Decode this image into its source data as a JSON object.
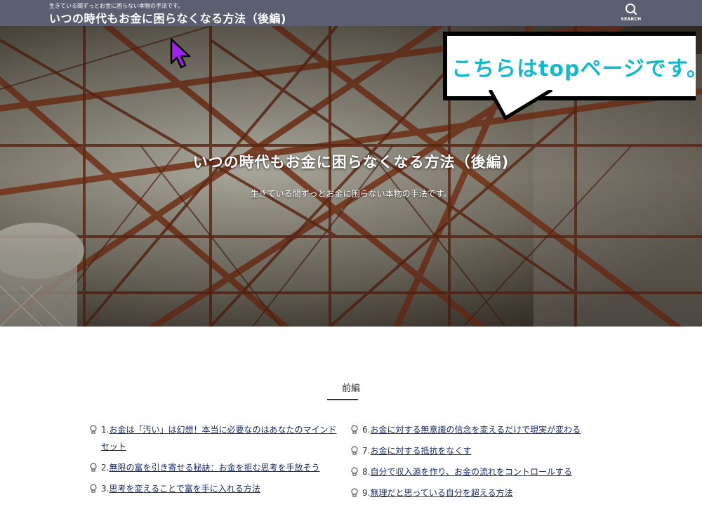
{
  "header": {
    "tagline": "生きている間ずっとお金に困らない本物の手法です。",
    "site_title": "いつの時代もお金に困らなくなる方法（後編)",
    "search_label": "SEARCH"
  },
  "hero": {
    "title": "いつの時代もお金に困らなくなる方法（後編)",
    "subtitle": "生きている間ずっとお金に困らない本物の手法です。"
  },
  "annotation": {
    "bubble_text": "こちらはtopページです。",
    "color": "#17b8c9"
  },
  "section": {
    "heading": "前編"
  },
  "toc": {
    "left": [
      {
        "num": "1.",
        "text": "お金は「汚い」は幻想！本当に必要なのはあなたのマインドセット"
      },
      {
        "num": "2.",
        "text": "無限の富を引き寄せる秘訣：お金を拒む思考を手放そう"
      },
      {
        "num": "3.",
        "text": "思考を変えることで富を手に入れる方法"
      }
    ],
    "right": [
      {
        "num": "6.",
        "text": "お金に対する無意識の信念を変えるだけで現実が変わる"
      },
      {
        "num": "7.",
        "text": "お金に対する抵抗をなくす"
      },
      {
        "num": "8.",
        "text": "自分で収入源を作り、お金の流れをコントロールする"
      },
      {
        "num": "9.",
        "text": "無理だと思っている自分を超える方法"
      }
    ]
  }
}
